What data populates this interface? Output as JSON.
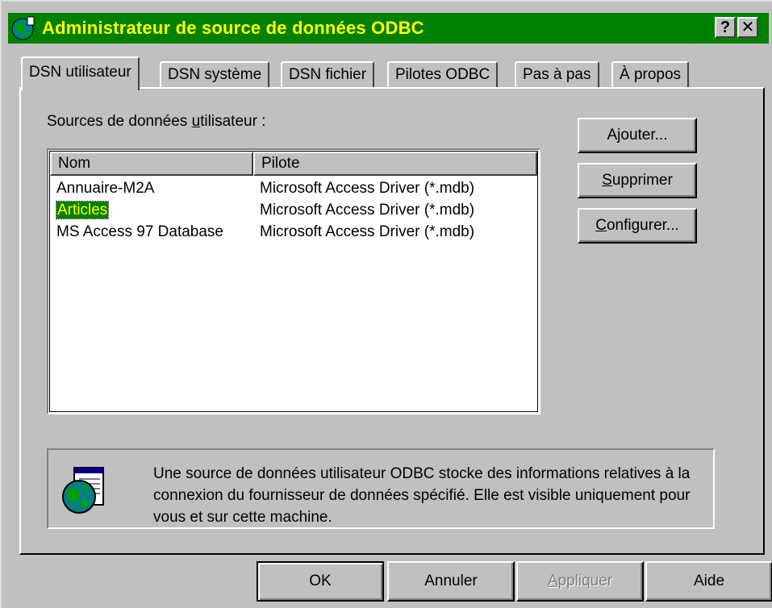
{
  "window": {
    "title": "Administrateur de source de données ODBC",
    "help_glyph": "?",
    "close_glyph": "✕",
    "colors": {
      "titlebar": "#008000",
      "title_text": "#ffff00",
      "face": "#c0c0c0"
    }
  },
  "tabs": [
    {
      "label": "DSN utilisateur",
      "active": true
    },
    {
      "label": "DSN système"
    },
    {
      "label": "DSN fichier"
    },
    {
      "label": "Pilotes ODBC"
    },
    {
      "label": "Pas à pas"
    },
    {
      "label": "À propos"
    }
  ],
  "main": {
    "sources_label_pre": "Sources de données ",
    "sources_label_u": "u",
    "sources_label_post": "tilisateur :",
    "columns": [
      "Nom",
      "Pilote"
    ],
    "rows": [
      {
        "nom": "Annuaire-M2A",
        "pilote": "Microsoft Access Driver (*.mdb)"
      },
      {
        "nom": "Articles",
        "pilote": "Microsoft Access Driver (*.mdb)",
        "selected": true
      },
      {
        "nom": "MS Access 97 Database",
        "pilote": "Microsoft Access Driver (*.mdb)"
      }
    ],
    "buttons": {
      "add": "Ajouter...",
      "remove_u": "S",
      "remove_rest": "upprimer",
      "configure_u": "C",
      "configure_rest": "onfigurer..."
    },
    "info": {
      "text": "Une source de données utilisateur ODBC stocke des informations relatives à la connexion du fournisseur de données spécifié. Elle est visible uniquement pour vous et sur cette machine.",
      "icon": "database-globe-icon"
    }
  },
  "footer": {
    "ok": "OK",
    "cancel": "Annuler",
    "apply_u": "A",
    "apply_rest": "ppliquer",
    "help": "Aide"
  }
}
